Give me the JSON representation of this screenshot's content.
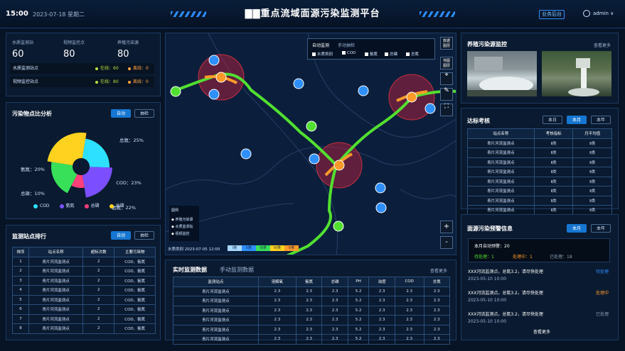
{
  "header": {
    "time": "15:00",
    "date": "2023-07-18  星期二",
    "title": "▇▇重点流域面源污染监测平台",
    "biz_btn": "业务后台",
    "user": "admin",
    "chevron": "∨"
  },
  "station_stats": {
    "items": [
      {
        "label": "水质监测站",
        "value": "60"
      },
      {
        "label": "视频监控点",
        "value": "80"
      },
      {
        "label": "养殖污染源",
        "value": "80"
      }
    ],
    "rows": [
      {
        "name": "水质监测站点",
        "online": "在线：60",
        "offline": "离线：0"
      },
      {
        "name": "视频监控站点",
        "online": "在线：80",
        "offline": "离线：0"
      }
    ]
  },
  "pollutant": {
    "title": "污染物点比分析",
    "btn_auto": "自动",
    "btn_manual": "抽检"
  },
  "chart_data": {
    "type": "pie",
    "title": "",
    "categories": [
      "COD",
      "氨氮",
      "总磷",
      "总氮"
    ],
    "labels": [
      "COD：23%",
      "氨氮：20%",
      "总磷：10%",
      "总氮：25%",
      "氨氮：22%"
    ],
    "slices": [
      {
        "name": "总氮",
        "value": 25,
        "color": "#ffd21f"
      },
      {
        "name": "COD",
        "value": 23,
        "color": "#2ee0ff"
      },
      {
        "name": "氨氮",
        "value": 22,
        "color": "#7b4fff"
      },
      {
        "name": "总磷",
        "value": 10,
        "color": "#ff3f7a"
      },
      {
        "name": "氨氮",
        "value": 20,
        "color": "#38e05a"
      }
    ],
    "legend": [
      {
        "name": "COD",
        "color": "#2ee0ff"
      },
      {
        "name": "氨氮",
        "color": "#7b4fff"
      },
      {
        "name": "总磷",
        "color": "#ff3f7a"
      },
      {
        "name": "总磷",
        "color": "#ffd21f"
      }
    ]
  },
  "ranking": {
    "title": "监测站点排行",
    "btn_auto": "自动",
    "btn_manual": "抽检",
    "headers": [
      "排序",
      "站点名称",
      "超标次数",
      "主要污染物"
    ],
    "rows": [
      [
        "1",
        "青片河流监测点",
        "2",
        "COD、氨氮"
      ],
      [
        "2",
        "青片河流监测点",
        "2",
        "COD、氨氮"
      ],
      [
        "3",
        "青片河流监测点",
        "2",
        "COD、氨氮"
      ],
      [
        "4",
        "青片河流监测点",
        "2",
        "COD、氨氮"
      ],
      [
        "5",
        "青片河流监测点",
        "2",
        "COD、氨氮"
      ],
      [
        "6",
        "青片河流监测点",
        "2",
        "COD、氨氮"
      ],
      [
        "7",
        "青片河流监测点",
        "2",
        "COD、氨氮"
      ],
      [
        "8",
        "青片河流监测点",
        "2",
        "COD、氨氮"
      ]
    ]
  },
  "map": {
    "tab_auto": "自动监测",
    "tab_manual": "手动抽检",
    "checks": [
      "水质类别",
      "COD",
      "氨氮",
      "总磷",
      "总氮"
    ],
    "tools": [
      "数据\n图层",
      "地图\n图层"
    ],
    "zoom_in": "+",
    "zoom_out": "-",
    "legend_title": "图例",
    "legend_items": [
      "养殖污染源",
      "水质监测站",
      "视频监控"
    ],
    "footer": "水质类别    2023-07-05 12:00",
    "scale": [
      "I类",
      "II类",
      "III类",
      "IV类",
      "V类"
    ],
    "scale_colors": [
      "#a8d8ff",
      "#2f8fff",
      "#38e05a",
      "#ffd21f",
      "#ff9a2a"
    ]
  },
  "realtime": {
    "tab1": "实时监测数据",
    "tab2": "手动监测数据",
    "more": "查看更多",
    "headers": [
      "监测站点",
      "溶解氧",
      "氨氮",
      "总磷",
      "PH",
      "浊度",
      "COD",
      "总氮"
    ],
    "rows": [
      [
        "青片河流监测点",
        "2.3",
        "2.3",
        "2.3",
        "5.2",
        "2.3",
        "2.3",
        "2.3"
      ],
      [
        "青片河流监测点",
        "2.3",
        "2.3",
        "2.3",
        "5.2",
        "2.3",
        "2.3",
        "2.3"
      ],
      [
        "青片河流监测点",
        "2.3",
        "2.3",
        "2.3",
        "5.2",
        "2.3",
        "2.3",
        "2.3"
      ],
      [
        "青片河流监测点",
        "2.3",
        "2.3",
        "2.3",
        "5.2",
        "2.3",
        "2.3",
        "2.3"
      ],
      [
        "青片河流监测点",
        "2.3",
        "2.3",
        "2.3",
        "5.2",
        "2.3",
        "2.3",
        "2.3"
      ],
      [
        "青片河流监测点",
        "2.3",
        "2.3",
        "2.3",
        "5.2",
        "2.3",
        "2.3",
        "2.3"
      ]
    ]
  },
  "farming": {
    "title": "养殖污染源监控",
    "more": "查看更多"
  },
  "compliance": {
    "title": "达标考核",
    "btn_day": "本日",
    "btn_month": "本月",
    "btn_year": "本年",
    "headers": [
      "站点名称",
      "考核指标",
      "月平均值"
    ],
    "rows": [
      [
        "青片河流监测点",
        "Ⅱ类",
        "Ⅱ类"
      ],
      [
        "青片河流监测点",
        "Ⅱ类",
        "Ⅱ类"
      ],
      [
        "青片河流监测点",
        "Ⅱ类",
        "Ⅱ类"
      ],
      [
        "青片河流监测点",
        "Ⅱ类",
        "Ⅱ类"
      ],
      [
        "青片河流监测点",
        "Ⅱ类",
        "Ⅱ类"
      ],
      [
        "青片河流监测点",
        "Ⅱ类",
        "Ⅱ类"
      ],
      [
        "青片河流监测点",
        "Ⅱ类",
        "Ⅱ类"
      ],
      [
        "青片河流监测点",
        "Ⅱ类",
        "Ⅱ类"
      ]
    ]
  },
  "warning": {
    "title": "面源污染预警信息",
    "btn_month": "本月",
    "btn_year": "本年",
    "total": "本月自动预警：20",
    "pending": "待处理：1",
    "processing": "处理中：1",
    "done": "已处理：18",
    "items": [
      {
        "text": "XXX河流监测点，总氮3.2，请尽快处理",
        "time": "2023-05-10 10:00",
        "status": "待处理",
        "color": "#2f8fff"
      },
      {
        "text": "XXX河流监测点，总氮3.2，请尽快处理",
        "time": "2023-05-10 10:00",
        "status": "处理中",
        "color": "#ff9a2a"
      },
      {
        "text": "XXX河流监测点，总氮3.2，请尽快处理",
        "time": "2023-05-10 10:00",
        "status": "已处理",
        "color": "#8aa0b8"
      }
    ],
    "more": "查看更多"
  }
}
